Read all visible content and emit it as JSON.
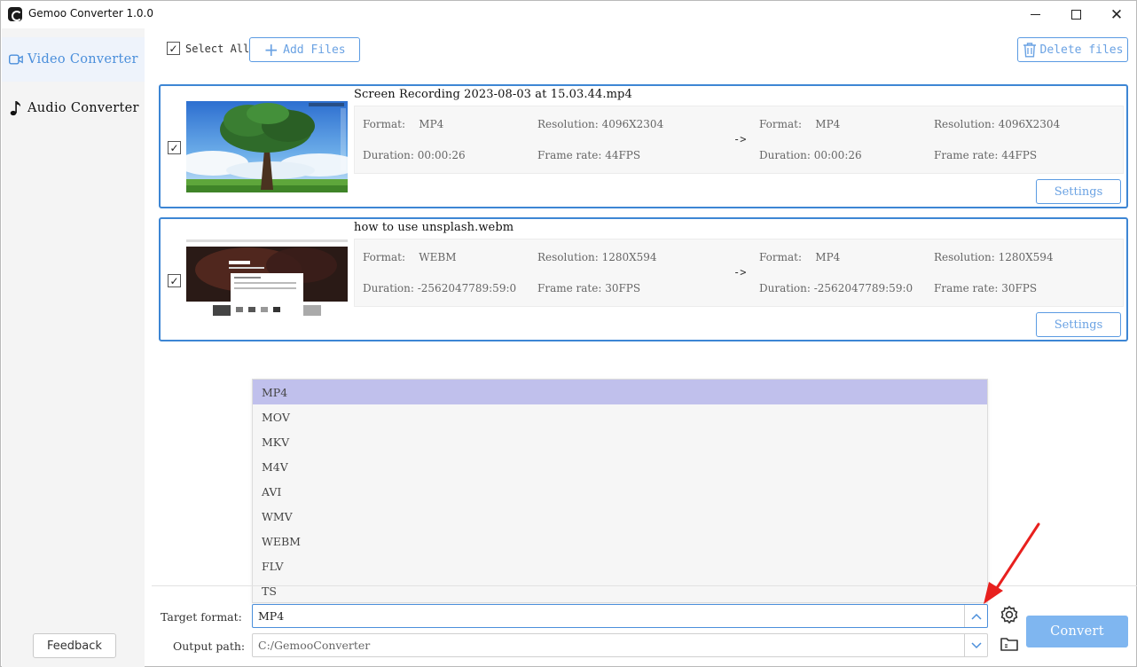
{
  "app": {
    "title": "Gemoo Converter 1.0.0"
  },
  "sidebar": {
    "items": [
      {
        "label": "Video Converter",
        "icon": "video-camera-icon",
        "active": true
      },
      {
        "label": "Audio Converter",
        "icon": "music-note-icon",
        "active": false
      }
    ],
    "feedback_label": "Feedback"
  },
  "toolbar": {
    "select_all_label": "Select All",
    "select_all_checked": true,
    "add_files_label": "Add Files",
    "delete_files_label": "Delete files"
  },
  "files": [
    {
      "name": "Screen Recording 2023-08-03 at 15.03.44.mp4",
      "checked": true,
      "source": {
        "format": "MP4",
        "resolution": "4096X2304",
        "duration": "00:00:26",
        "frame_rate": "44FPS"
      },
      "target": {
        "format": "MP4",
        "resolution": "4096X2304",
        "duration": "00:00:26",
        "frame_rate": "44FPS"
      },
      "settings_label": "Settings"
    },
    {
      "name": "how to use unsplash.webm",
      "checked": true,
      "source": {
        "format": "WEBM",
        "resolution": "1280X594",
        "duration": "-2562047789:59:0",
        "frame_rate": "30FPS"
      },
      "target": {
        "format": "MP4",
        "resolution": "1280X594",
        "duration": "-2562047789:59:0",
        "frame_rate": "30FPS"
      },
      "settings_label": "Settings"
    }
  ],
  "labels": {
    "format": "Format:",
    "resolution": "Resolution:",
    "duration": "Duration:",
    "frame_rate": "Frame rate:",
    "arrow": "->"
  },
  "format_dropdown": {
    "options": [
      "MP4",
      "MOV",
      "MKV",
      "M4V",
      "AVI",
      "WMV",
      "WEBM",
      "FLV",
      "TS"
    ],
    "selected": "MP4"
  },
  "bottom": {
    "target_format_label": "Target format:",
    "target_format_value": "MP4",
    "output_path_label": "Output path:",
    "output_path_value": "C:/GemooConverter",
    "convert_label": "Convert"
  },
  "colors": {
    "accent": "#4b8fdb",
    "convert_button": "#7fb6f0",
    "dropdown_selected": "#c0c0ec",
    "annotation_arrow": "#e8201e"
  }
}
